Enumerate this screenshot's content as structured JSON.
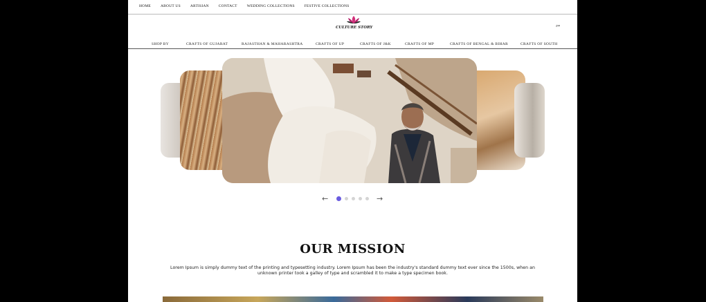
{
  "top_nav": {
    "items": [
      "HOME",
      "ABOUT US",
      "ARTISIAN",
      "CONTACT",
      "WEDDING COLLECTIONS",
      "FESTIVE COLLECTIONS"
    ]
  },
  "logo": {
    "brand": "CULTURE STORY"
  },
  "icons": {
    "search": "search-icon",
    "dropdown": "caret-down-icon",
    "prev": "arrow-left-icon",
    "next": "arrow-right-icon"
  },
  "category_nav": {
    "items": [
      "SHOP BY",
      "CRAFTS OF GUJARAT",
      "RAJASTHAN & MAHARASHTRA",
      "CRAFTS OF UP",
      "CRAFTS OF J&K",
      "CRAFTS OF MP",
      "CRAFTS OF BENGAL & BIHAR",
      "CRAFTS OF SOUTH"
    ]
  },
  "carousel": {
    "slide_count": 5,
    "active_index": 0
  },
  "mission": {
    "title": "OUR MISSION",
    "text": "Lorem Ipsum is simply dummy text of the printing and typesetting industry. Lorem Ipsum has been the industry's standard dummy text ever since the 1500s, when an unknown printer took a galley of type and scrambled it to make a type specimen book."
  },
  "colors": {
    "accent": "#6a5ce0",
    "logo_pink": "#d2307a",
    "background": "#000000"
  }
}
